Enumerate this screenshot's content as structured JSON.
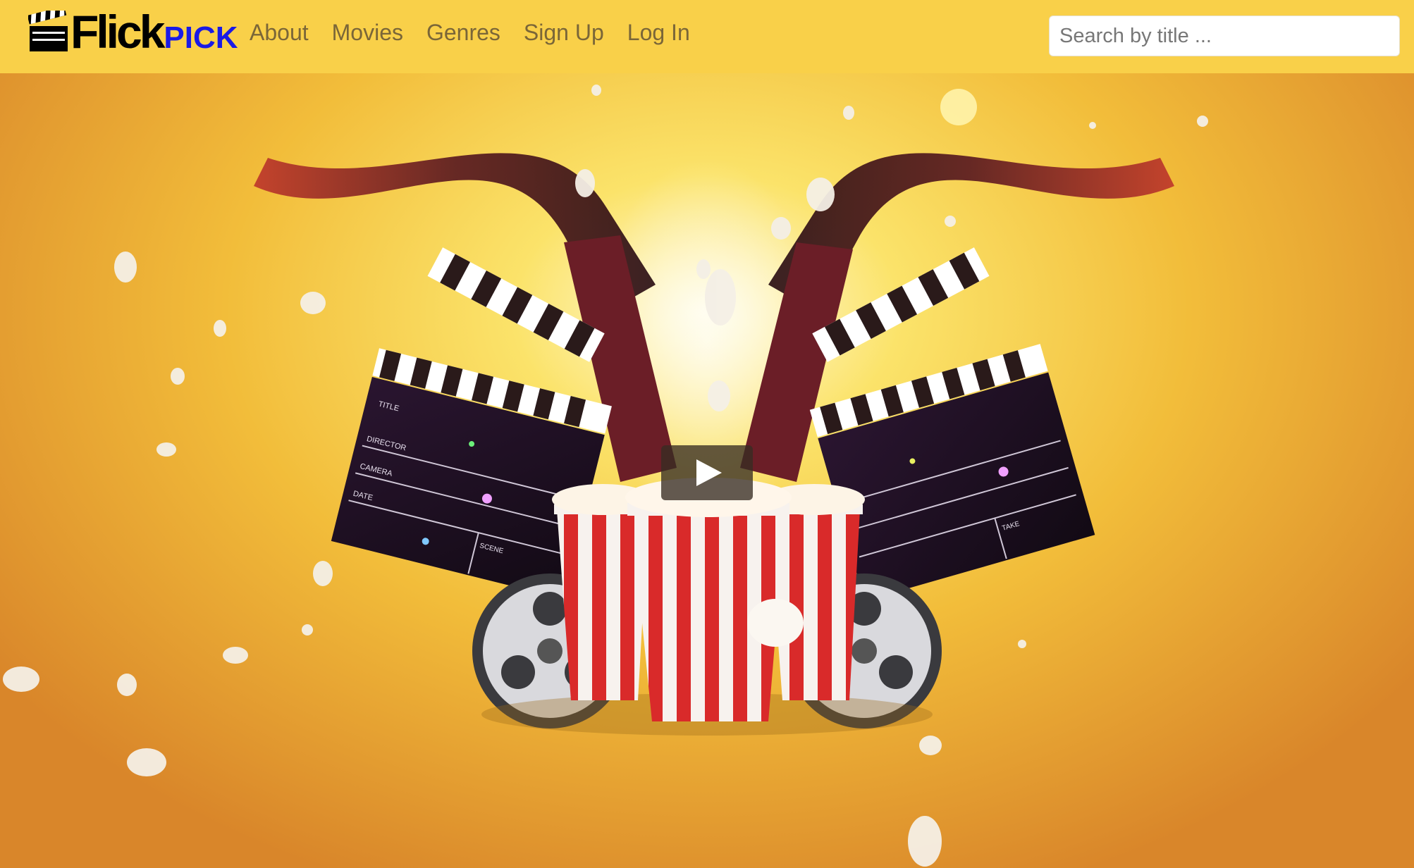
{
  "brand": {
    "name_part1": "Flick",
    "name_part2": "PICK",
    "part2_color": "#1a1ae6"
  },
  "nav": {
    "items": [
      {
        "label": "About"
      },
      {
        "label": "Movies"
      },
      {
        "label": "Genres"
      },
      {
        "label": "Sign Up"
      },
      {
        "label": "Log In"
      }
    ]
  },
  "search": {
    "placeholder": "Search by title ...",
    "value": ""
  },
  "hero": {
    "video": {
      "control": "play-icon"
    },
    "clapperboard_left": {
      "labels": [
        "TITLE",
        "DIRECTOR",
        "CAMERA",
        "DATE",
        "SCENE"
      ]
    },
    "clapperboard_right": {
      "labels": [
        "TAKE"
      ]
    }
  },
  "colors": {
    "navbar": "#f9d049",
    "nav_link": "#7a6638",
    "hero_center": "#fbe36a",
    "hero_edge": "#d9862a"
  }
}
